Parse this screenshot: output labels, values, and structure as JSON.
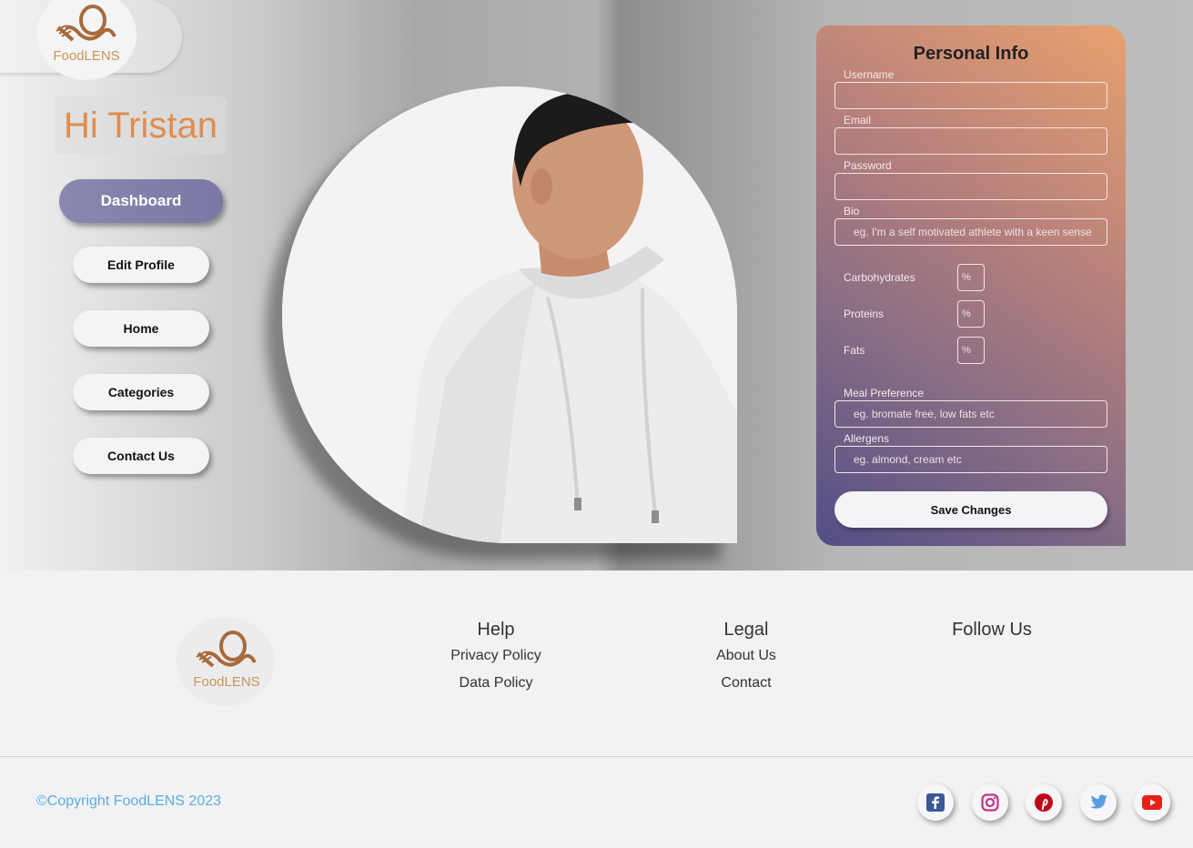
{
  "brand": {
    "name": "FoodLENS",
    "logo_text": "FoodLENS"
  },
  "sidebar": {
    "greeting": "Hi Tristan",
    "items": [
      {
        "label": "Dashboard",
        "active": true
      },
      {
        "label": "Edit Profile"
      },
      {
        "label": "Home"
      },
      {
        "label": "Categories"
      },
      {
        "label": "Contact Us"
      }
    ]
  },
  "profile_photo": {
    "alt": "profile-photo"
  },
  "form": {
    "title": "Personal Info",
    "username": {
      "label": "Username",
      "value": "",
      "placeholder": ""
    },
    "email": {
      "label": "Email",
      "value": "",
      "placeholder": ""
    },
    "password": {
      "label": "Password",
      "value": "",
      "placeholder": ""
    },
    "bio": {
      "label": "Bio",
      "placeholder": "eg. I'm a self motivated athlete with a keen sense"
    },
    "macros": [
      {
        "label": "Carbohydrates",
        "placeholder": "%"
      },
      {
        "label": "Proteins",
        "placeholder": "%"
      },
      {
        "label": "Fats",
        "placeholder": "%"
      }
    ],
    "meal_preference": {
      "label": "Meal Preference",
      "placeholder": "eg. bromate free, low fats etc"
    },
    "allergens": {
      "label": "Allergens",
      "placeholder": "eg. almond, cream etc"
    },
    "save_label": "Save Changes"
  },
  "footer": {
    "help": {
      "heading": "Help",
      "links": [
        "Privacy Policy",
        "Data Policy"
      ]
    },
    "legal": {
      "heading": "Legal",
      "links": [
        "About Us",
        "Contact"
      ]
    },
    "follow": {
      "heading": "Follow Us"
    },
    "copyright": "©Copyright FoodLENS 2023",
    "social": [
      "facebook-icon",
      "instagram-icon",
      "pinterest-icon",
      "twitter-icon",
      "youtube-icon"
    ]
  },
  "colors": {
    "accent_orange": "#e08d4f",
    "dashboard_purple": "#807ea9",
    "copyright_blue": "#5aaee0"
  }
}
